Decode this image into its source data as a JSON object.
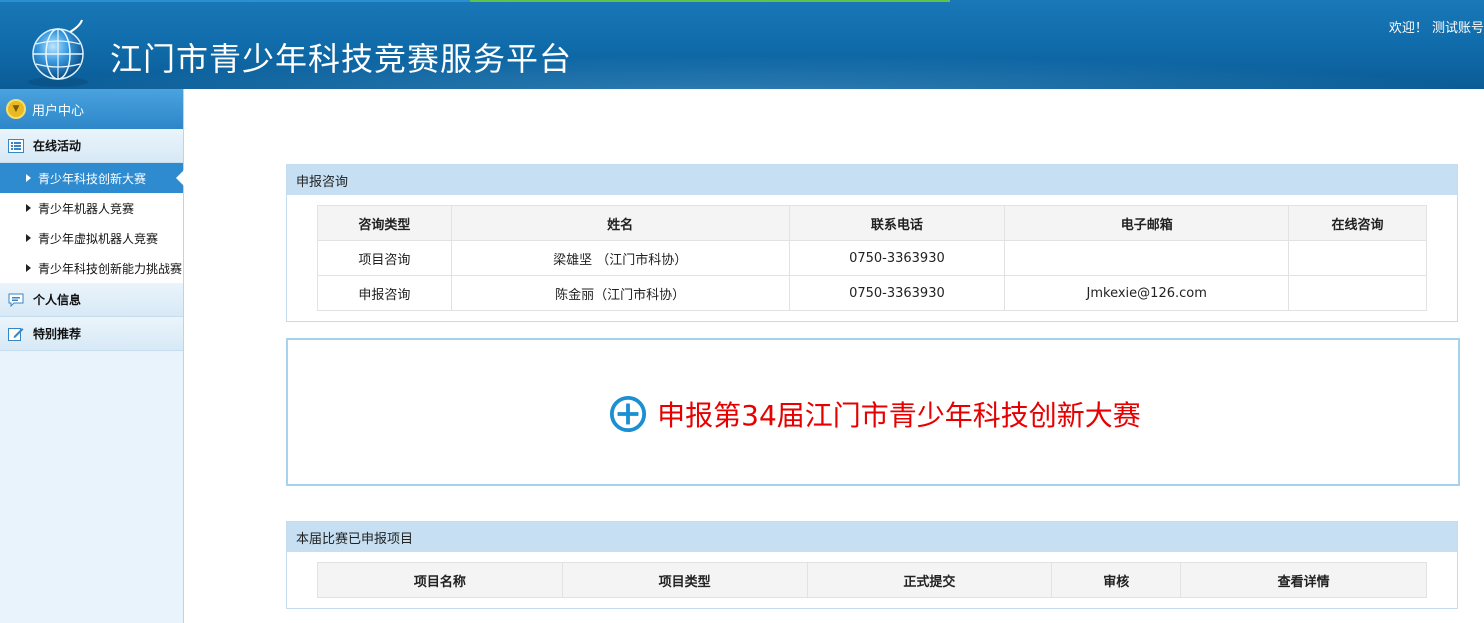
{
  "header": {
    "title": "江门市青少年科技竞赛服务平台",
    "welcome": "欢迎！ 测试账号"
  },
  "sidebar": {
    "head": "用户中心",
    "groups": [
      {
        "label": "在线活动",
        "icon": "list-icon"
      },
      {
        "label": "个人信息",
        "icon": "message-icon"
      },
      {
        "label": "特别推荐",
        "icon": "edit-icon"
      }
    ],
    "activities": [
      {
        "label": "青少年科技创新大赛",
        "active": true
      },
      {
        "label": "青少年机器人竞赛",
        "active": false
      },
      {
        "label": "青少年虚拟机器人竞赛",
        "active": false
      },
      {
        "label": "青少年科技创新能力挑战赛",
        "active": false
      }
    ]
  },
  "consult": {
    "title": "申报咨询",
    "columns": [
      "咨询类型",
      "姓名",
      "联系电话",
      "电子邮箱",
      "在线咨询"
    ],
    "rows": [
      [
        "项目咨询",
        "梁雄坚 （江门市科协）",
        "0750-3363930",
        "",
        ""
      ],
      [
        "申报咨询",
        "陈金丽（江门市科协）",
        "0750-3363930",
        "Jmkexie@126.com",
        ""
      ]
    ]
  },
  "apply": {
    "label": "申报第34届江门市青少年科技创新大赛",
    "icon": "plus-circle-icon"
  },
  "projects": {
    "title": "本届比赛已申报项目",
    "columns": [
      "项目名称",
      "项目类型",
      "正式提交",
      "审核",
      "查看详情"
    ]
  },
  "colors": {
    "header_blue": "#0f6aa8",
    "accent_blue": "#2e8bd0",
    "apply_red": "#e60000",
    "plus_blue": "#1b8fd2"
  }
}
